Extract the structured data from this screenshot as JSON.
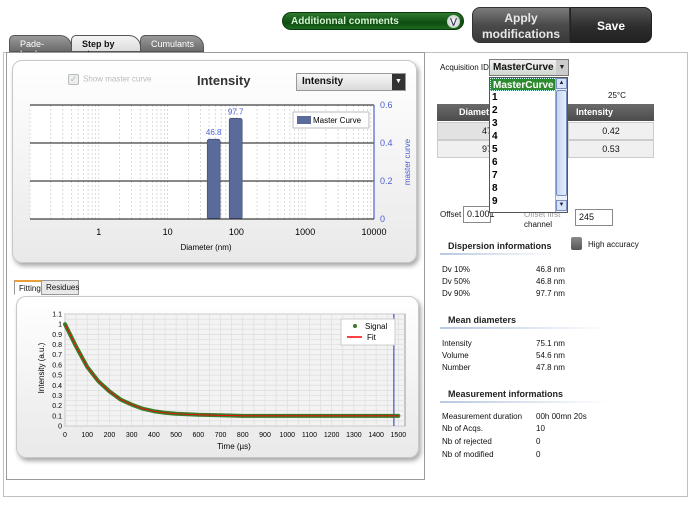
{
  "header": {
    "comments_label": "Additionnal comments",
    "apply_label_1": "Apply",
    "apply_label_2": "modifications",
    "save_label": "Save"
  },
  "tabs": [
    {
      "label": "Pade-Laplace",
      "active": false
    },
    {
      "label": "Step by step",
      "active": true
    },
    {
      "label": "Cumulants",
      "active": false
    }
  ],
  "distribution_panel": {
    "show_master_label": "Show master curve",
    "title": "Intensity",
    "select_value": "Intensity",
    "legend": "Master Curve",
    "xlabel": "Diameter (nm)",
    "ylabel_right": "master curve",
    "x_ticks": [
      "1",
      "10",
      "100",
      "1000",
      "10000"
    ],
    "y_ticks": [
      "0",
      "0.2",
      "0.4",
      "0.6"
    ]
  },
  "fitting_tabs": [
    {
      "label": "Fitting",
      "active": true
    },
    {
      "label": "Residues",
      "active": false
    }
  ],
  "fitting_panel": {
    "legend_signal": "Signal",
    "legend_fit": "Fit",
    "xlabel": "Time (µs)",
    "ylabel": "Intensity (a.u.)",
    "x_ticks": [
      "0",
      "100",
      "200",
      "300",
      "400",
      "500",
      "600",
      "700",
      "800",
      "900",
      "1000",
      "1100",
      "1200",
      "1300",
      "1400",
      "1500"
    ],
    "y_ticks": [
      "0",
      "0.1",
      "0.2",
      "0.3",
      "0.4",
      "0.5",
      "0.6",
      "0.7",
      "0.8",
      "0.9",
      "1",
      "1.1"
    ]
  },
  "chart_data": [
    {
      "type": "bar",
      "title": "Intensity",
      "xlabel": "Diameter (nm)",
      "ylabel": "master curve",
      "x_scale": "log",
      "xlim": [
        0.1,
        10000
      ],
      "ylim": [
        0,
        0.6
      ],
      "series": [
        {
          "name": "Master Curve",
          "x": [
            46.8,
            97.7
          ],
          "values": [
            0.42,
            0.53
          ],
          "labels": [
            "46.8",
            "97.7"
          ]
        }
      ],
      "color": "#5a6a9a"
    },
    {
      "type": "line",
      "xlabel": "Time (µs)",
      "ylabel": "Intensity (a.u.)",
      "xlim": [
        0,
        1530
      ],
      "ylim": [
        0,
        1.1
      ],
      "series": [
        {
          "name": "Signal",
          "x": [
            0,
            50,
            100,
            150,
            200,
            250,
            300,
            350,
            400,
            450,
            500,
            600,
            700,
            800,
            900,
            1000,
            1100,
            1200,
            1300,
            1400,
            1500
          ],
          "values": [
            1.0,
            0.78,
            0.58,
            0.44,
            0.34,
            0.26,
            0.21,
            0.17,
            0.145,
            0.13,
            0.12,
            0.11,
            0.105,
            0.1,
            0.1,
            0.1,
            0.1,
            0.1,
            0.1,
            0.1,
            0.1
          ],
          "color": "#3d7a2a"
        },
        {
          "name": "Fit",
          "x": [
            0,
            50,
            100,
            150,
            200,
            250,
            300,
            350,
            400,
            450,
            500,
            600,
            700,
            800,
            900,
            1000,
            1100,
            1200,
            1300,
            1400,
            1500
          ],
          "values": [
            1.0,
            0.78,
            0.58,
            0.44,
            0.34,
            0.26,
            0.21,
            0.17,
            0.145,
            0.13,
            0.12,
            0.11,
            0.105,
            0.1,
            0.1,
            0.1,
            0.1,
            0.1,
            0.1,
            0.1,
            0.1
          ],
          "color": "#ff0000"
        }
      ]
    }
  ],
  "right": {
    "acq_label": "Acquisition ID",
    "acq_value": "MasterCurve",
    "acq_options": [
      "MasterCurve",
      "1",
      "2",
      "3",
      "4",
      "5",
      "6",
      "7",
      "8",
      "9"
    ],
    "temperature": "25°C",
    "table_headers": [
      "Diameter",
      "Intensity"
    ],
    "table_rows": [
      {
        "diameter": "47",
        "intensity": "0.42"
      },
      {
        "diameter": "97",
        "intensity": "0.53"
      }
    ],
    "offset_label": "Offset",
    "offset_value": "0.1001",
    "offset_first_label": "Offset first",
    "channel_label": "channel",
    "channel_value": "245",
    "dispersion_title": "Dispersion informations",
    "high_accuracy_label": "High accuracy",
    "dispersion": [
      {
        "label": "Dv 10%",
        "value": "46.8 nm"
      },
      {
        "label": "Dv 50%",
        "value": "46.8 nm"
      },
      {
        "label": "Dv 90%",
        "value": "97.7 nm"
      }
    ],
    "mean_title": "Mean diameters",
    "mean": [
      {
        "label": "Intensity",
        "value": "75.1 nm"
      },
      {
        "label": "Volume",
        "value": "54.6 nm"
      },
      {
        "label": "Number",
        "value": "47.8 nm"
      }
    ],
    "measure_title": "Measurement informations",
    "measure": [
      {
        "label": "Measurement duration",
        "value": "00h 00mn 20s"
      },
      {
        "label": "Nb of Acqs.",
        "value": "10"
      },
      {
        "label": "Nb of rejected",
        "value": "0"
      },
      {
        "label": "Nb of modified",
        "value": "0"
      }
    ]
  }
}
